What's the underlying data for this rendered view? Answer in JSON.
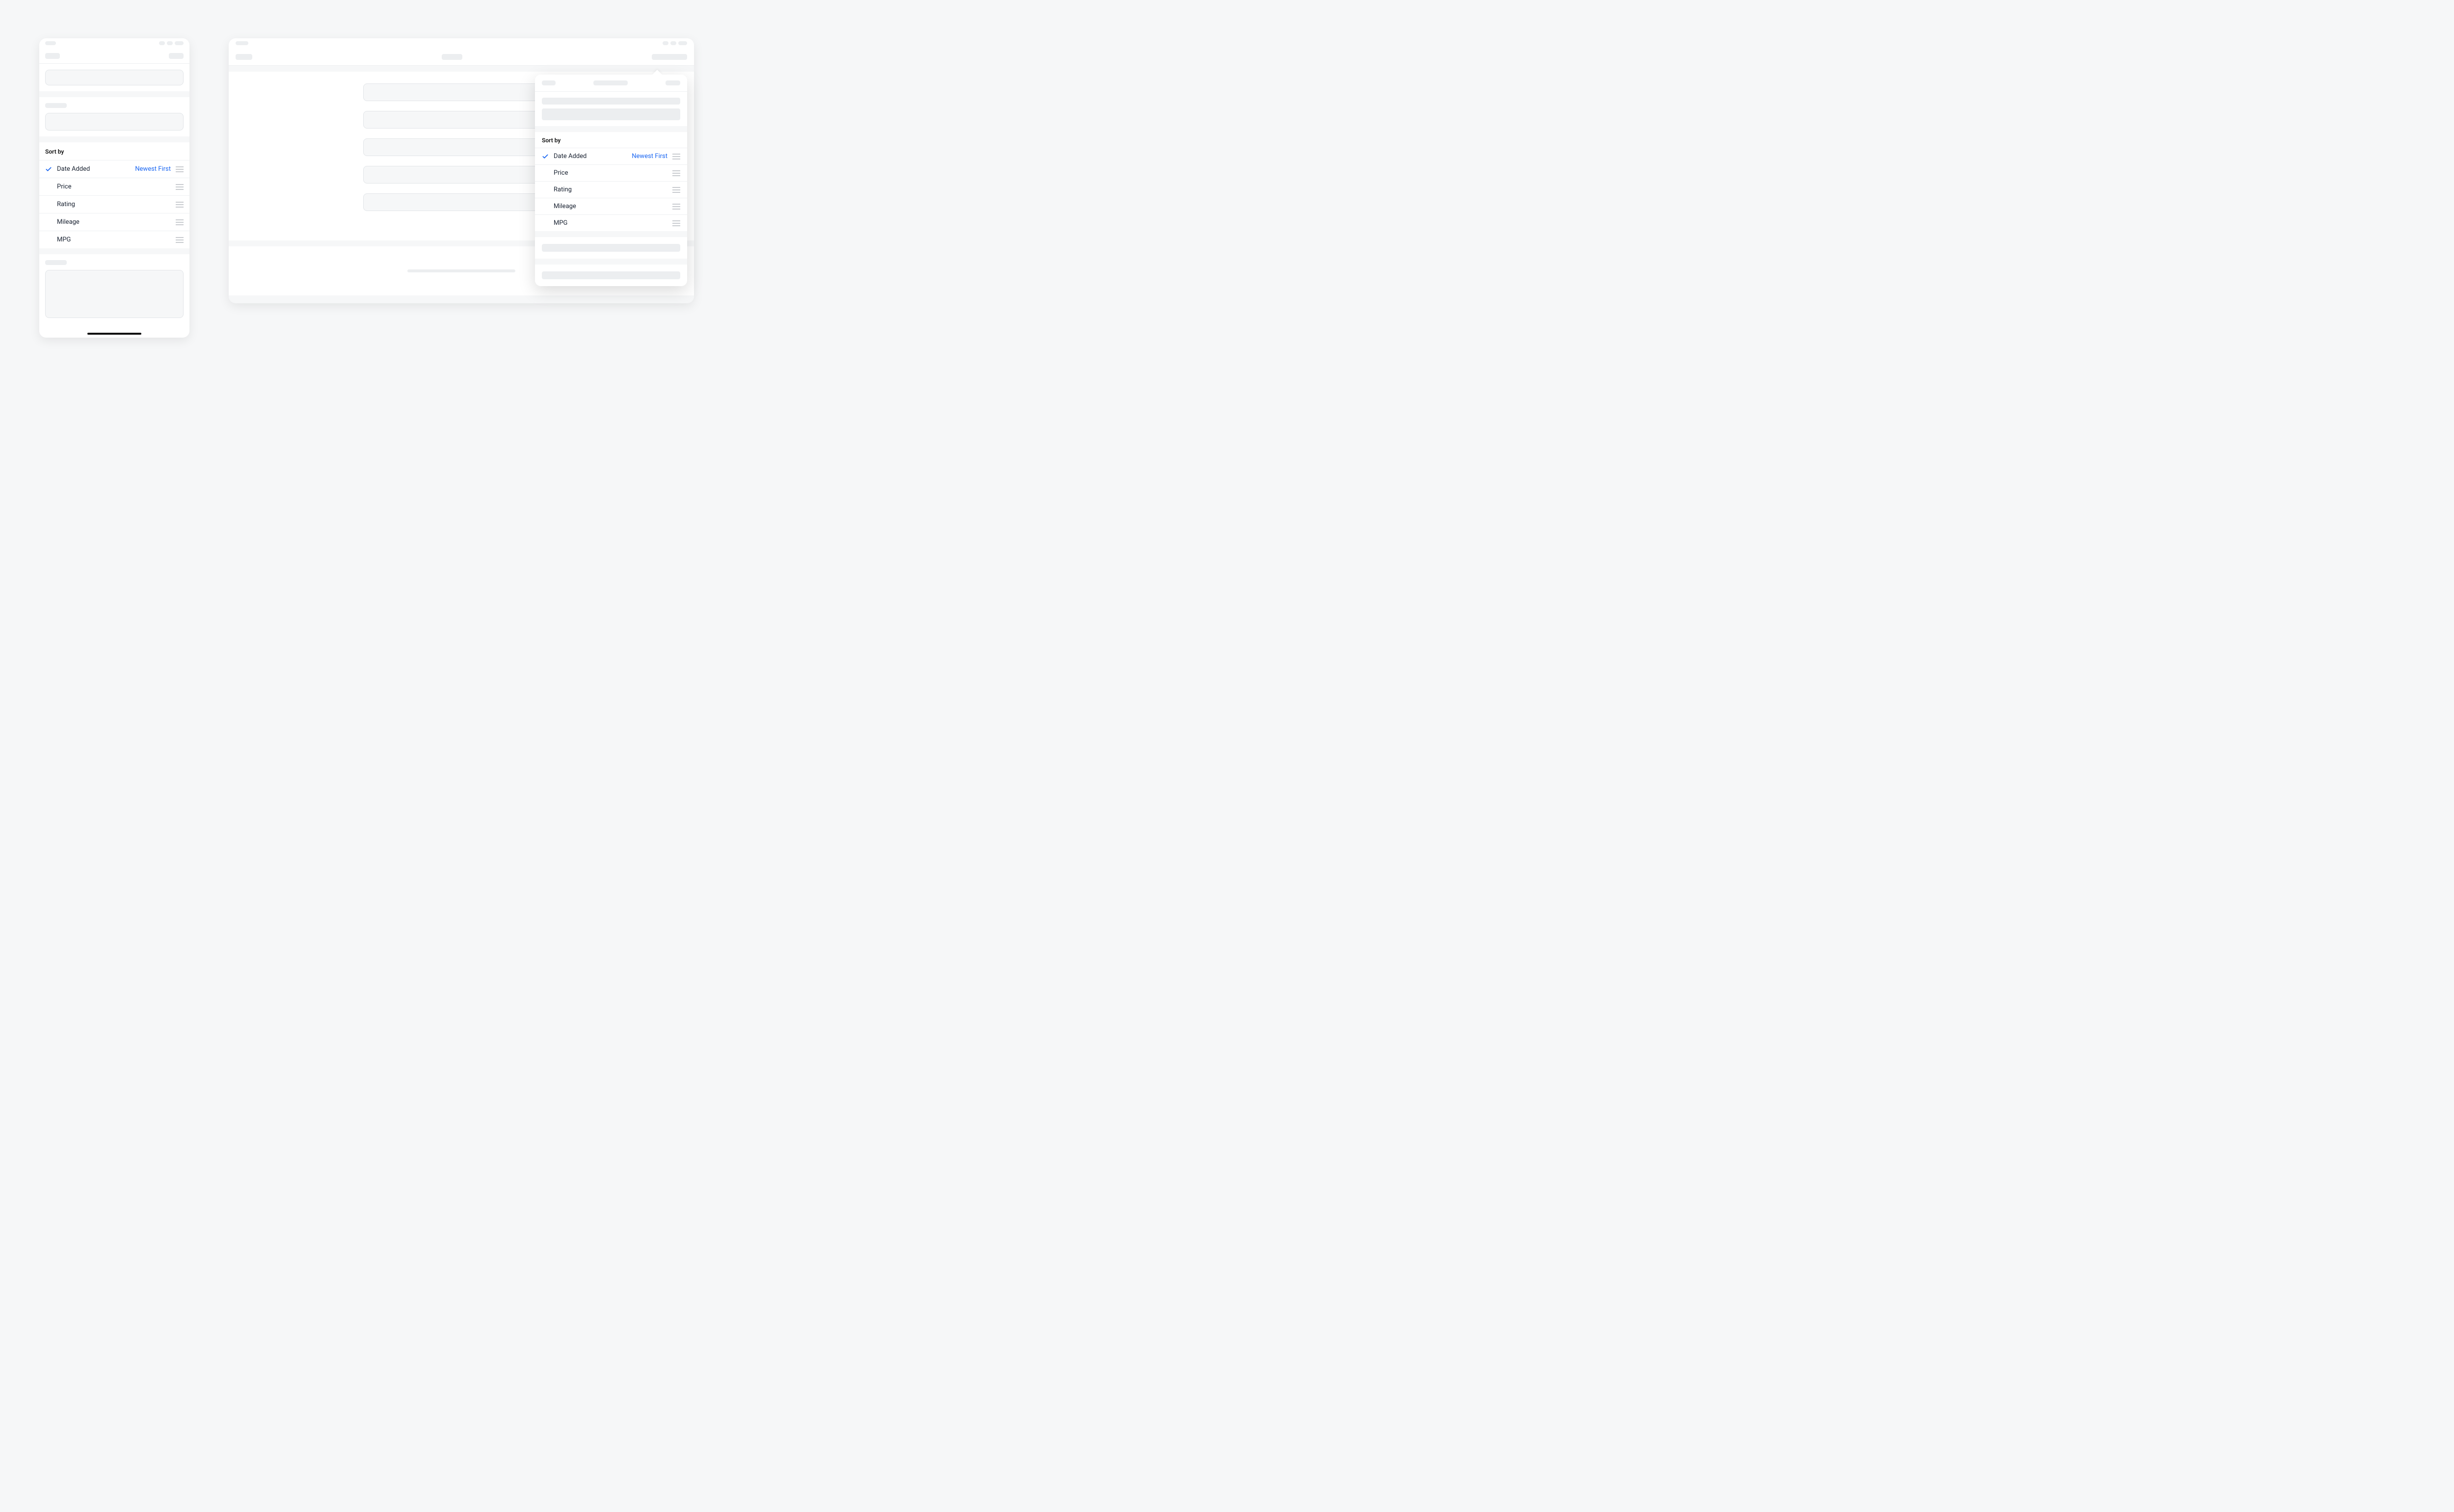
{
  "sort": {
    "header": "Sort by",
    "active_direction": "Newest First",
    "options": [
      {
        "label": "Date Added",
        "selected": true
      },
      {
        "label": "Price",
        "selected": false
      },
      {
        "label": "Rating",
        "selected": false
      },
      {
        "label": "Mileage",
        "selected": false
      },
      {
        "label": "MPG",
        "selected": false
      }
    ]
  }
}
